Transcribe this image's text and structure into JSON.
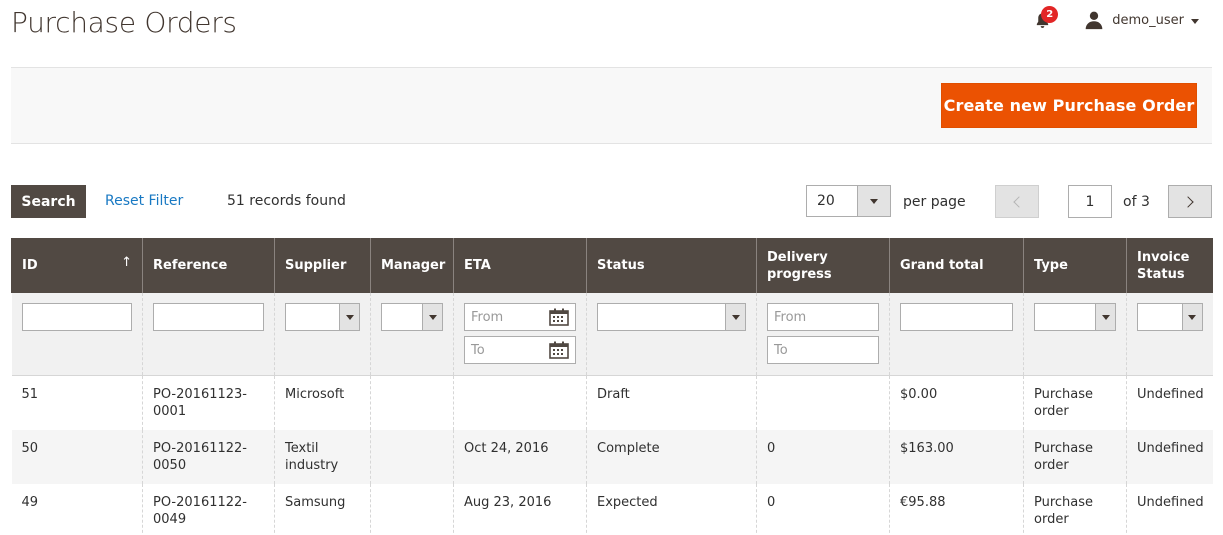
{
  "page": {
    "title": "Purchase Orders"
  },
  "header": {
    "notification_count": "2",
    "username": "demo_user"
  },
  "actions": {
    "create_label": "Create new Purchase Order"
  },
  "toolbar": {
    "search_label": "Search",
    "reset_label": "Reset Filter",
    "records_found": "51 records found",
    "per_page_value": "20",
    "per_page_label": "per page",
    "current_page": "1",
    "page_total": "of 3"
  },
  "columns": [
    {
      "key": "id",
      "label": "ID"
    },
    {
      "key": "reference",
      "label": "Reference"
    },
    {
      "key": "supplier",
      "label": "Supplier"
    },
    {
      "key": "manager",
      "label": "Manager"
    },
    {
      "key": "eta",
      "label": "ETA"
    },
    {
      "key": "status",
      "label": "Status"
    },
    {
      "key": "delivery",
      "label": "Delivery progress"
    },
    {
      "key": "grand_total",
      "label": "Grand total"
    },
    {
      "key": "type",
      "label": "Type"
    },
    {
      "key": "invoice_status",
      "label": "Invoice Status"
    }
  ],
  "sort_indicator": "↑",
  "filters": {
    "from_placeholder": "From",
    "to_placeholder": "To"
  },
  "rows": [
    {
      "id": "51",
      "reference": "PO-20161123-0001",
      "supplier": "Microsoft",
      "manager": "",
      "eta": "",
      "status": "Draft",
      "delivery": "",
      "grand_total": "$0.00",
      "type": "Purchase order",
      "invoice_status": "Undefined"
    },
    {
      "id": "50",
      "reference": "PO-20161122-0050",
      "supplier": "Textil industry",
      "manager": "",
      "eta": "Oct 24, 2016",
      "status": "Complete",
      "delivery": "0",
      "grand_total": "$163.00",
      "type": "Purchase order",
      "invoice_status": "Undefined"
    },
    {
      "id": "49",
      "reference": "PO-20161122-0049",
      "supplier": "Samsung",
      "manager": "",
      "eta": "Aug 23, 2016",
      "status": "Expected",
      "delivery": "0",
      "grand_total": "€95.88",
      "type": "Purchase order",
      "invoice_status": "Undefined"
    }
  ],
  "colors": {
    "accent": "#eb5202",
    "header_bg": "#514943",
    "link": "#1979c3",
    "badge": "#e22626"
  }
}
